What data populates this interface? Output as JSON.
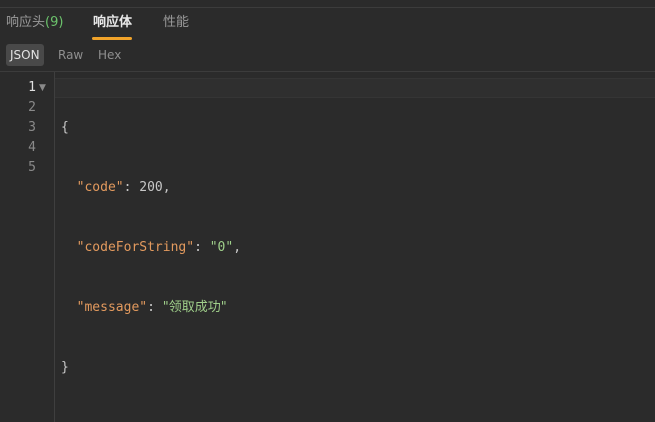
{
  "tabs": [
    {
      "label": "响应头",
      "count": "(9)",
      "active": false
    },
    {
      "label": "响应体",
      "active": true
    },
    {
      "label": "性能",
      "active": false
    }
  ],
  "colors": {
    "background": "#2b2b2b",
    "active_tab_underline": "#f0a32a",
    "count_green": "#6cc36c",
    "json_key": "#e39a5e",
    "json_string": "#9fcf8a"
  },
  "formats": [
    {
      "label": "JSON",
      "selected": true
    },
    {
      "label": "Raw",
      "selected": false
    },
    {
      "label": "Hex",
      "selected": false
    }
  ],
  "editor": {
    "line_numbers": [
      "1",
      "2",
      "3",
      "4",
      "5"
    ],
    "fold_icon": "fold-triangle-down-icon",
    "lines": [
      {
        "open": "{"
      },
      {
        "key": "\"code\"",
        "sep": ": ",
        "value": "200",
        "tail": ","
      },
      {
        "key": "\"codeForString\"",
        "sep": ": ",
        "value": "\"0\"",
        "tail": ","
      },
      {
        "key": "\"message\"",
        "sep": ": ",
        "value": "\"领取成功\"",
        "tail": ""
      },
      {
        "close": "}"
      }
    ]
  }
}
